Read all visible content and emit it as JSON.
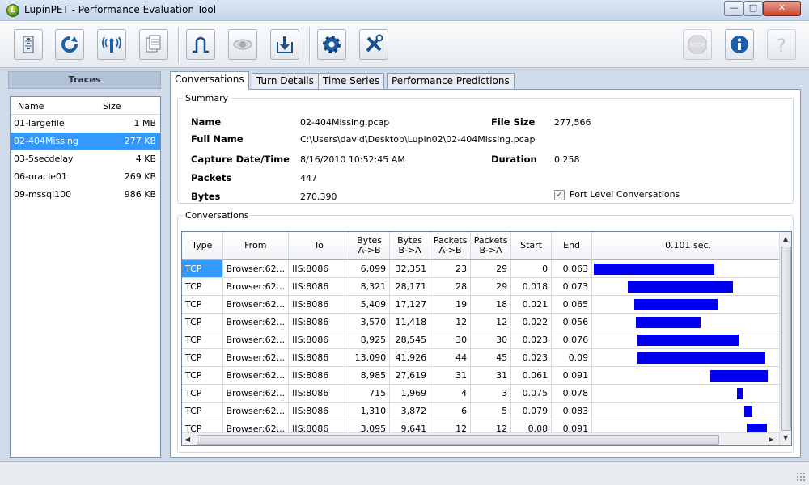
{
  "window": {
    "title": "LupinPET - Performance Evaluation Tool",
    "icon_letter": "L"
  },
  "toolbar": {
    "buttons": [
      "open-file-icon",
      "refresh-icon",
      "capture-icon",
      "documents-icon",
      "graph-icon",
      "view-icon",
      "export-icon",
      "settings-icon",
      "tools-icon",
      "stop-icon",
      "info-icon",
      "help-icon"
    ],
    "stop_label": "STOP"
  },
  "traces": {
    "header": "Traces",
    "columns": {
      "name": "Name",
      "size": "Size"
    },
    "rows": [
      {
        "name": "01-largefile",
        "size": "1 MB"
      },
      {
        "name": "02-404Missing",
        "size": "277 KB"
      },
      {
        "name": "03-5secdelay",
        "size": "4 KB"
      },
      {
        "name": "06-oracle01",
        "size": "269 KB"
      },
      {
        "name": "09-mssql100",
        "size": "986 KB"
      }
    ]
  },
  "tabs": [
    "Conversations",
    "Turn Details",
    "Time Series",
    "Performance Predictions"
  ],
  "summary": {
    "legend": "Summary",
    "name_label": "Name",
    "name_value": "02-404Missing.pcap",
    "fullname_label": "Full Name",
    "fullname_value": "C:\\Users\\david\\Desktop\\Lupin02\\02-404Missing.pcap",
    "capture_label": "Capture Date/Time",
    "capture_value": "8/16/2010 10:52:45 AM",
    "packets_label": "Packets",
    "packets_value": "447",
    "bytes_label": "Bytes",
    "bytes_value": "270,390",
    "filesize_label": "File Size",
    "filesize_value": "277,566",
    "duration_label": "Duration",
    "duration_value": "0.258",
    "port_level_label": "Port Level Conversations",
    "port_level_checked": true
  },
  "conversations": {
    "legend": "Conversations",
    "columns": [
      "Type",
      "From",
      "To",
      "Bytes\nA->B",
      "Bytes\nB->A",
      "Packets\nA->B",
      "Packets\nB->A",
      "Start",
      "End",
      "0.101 sec."
    ],
    "timeline_max": 0.101,
    "rows": [
      [
        "TCP",
        "Browser:62...",
        "IIS:8086",
        "6,099",
        "32,351",
        "23",
        "29",
        "0",
        "0.063"
      ],
      [
        "TCP",
        "Browser:62...",
        "IIS:8086",
        "8,321",
        "28,171",
        "28",
        "29",
        "0.018",
        "0.073"
      ],
      [
        "TCP",
        "Browser:62...",
        "IIS:8086",
        "5,409",
        "17,127",
        "19",
        "18",
        "0.021",
        "0.065"
      ],
      [
        "TCP",
        "Browser:62...",
        "IIS:8086",
        "3,570",
        "11,418",
        "12",
        "12",
        "0.022",
        "0.056"
      ],
      [
        "TCP",
        "Browser:62...",
        "IIS:8086",
        "8,925",
        "28,545",
        "30",
        "30",
        "0.023",
        "0.076"
      ],
      [
        "TCP",
        "Browser:62...",
        "IIS:8086",
        "13,090",
        "41,926",
        "44",
        "45",
        "0.023",
        "0.09"
      ],
      [
        "TCP",
        "Browser:62...",
        "IIS:8086",
        "8,985",
        "27,619",
        "31",
        "31",
        "0.061",
        "0.091"
      ],
      [
        "TCP",
        "Browser:62...",
        "IIS:8086",
        "715",
        "1,969",
        "4",
        "3",
        "0.075",
        "0.078"
      ],
      [
        "TCP",
        "Browser:62...",
        "IIS:8086",
        "1,310",
        "3,872",
        "6",
        "5",
        "0.079",
        "0.083"
      ],
      [
        "TCP",
        "Browser:62...",
        "IIS:8086",
        "3,095",
        "9,641",
        "12",
        "12",
        "0.08",
        "0.091"
      ]
    ]
  },
  "colors": {
    "selection": "#3399ff",
    "bar": "#0000ee",
    "traces_header": "#b3c2d6"
  }
}
